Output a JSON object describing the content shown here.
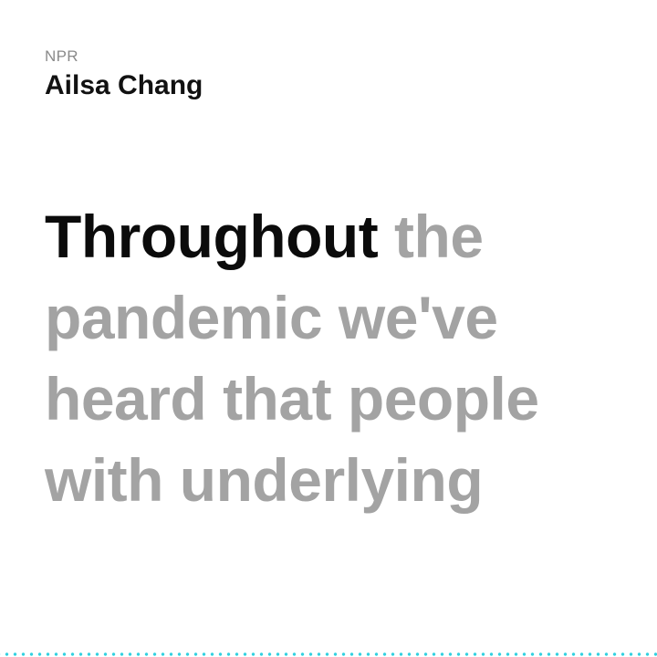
{
  "header": {
    "source": "NPR",
    "author": "Ailsa Chang"
  },
  "caption": {
    "spoken": "Throughout",
    "upcoming": "the pandemic we've heard that people with underlying"
  },
  "colors": {
    "spoken_text": "#0b0b0b",
    "upcoming_text": "#a3a3a3",
    "progress_dots": "#33d1e0"
  }
}
